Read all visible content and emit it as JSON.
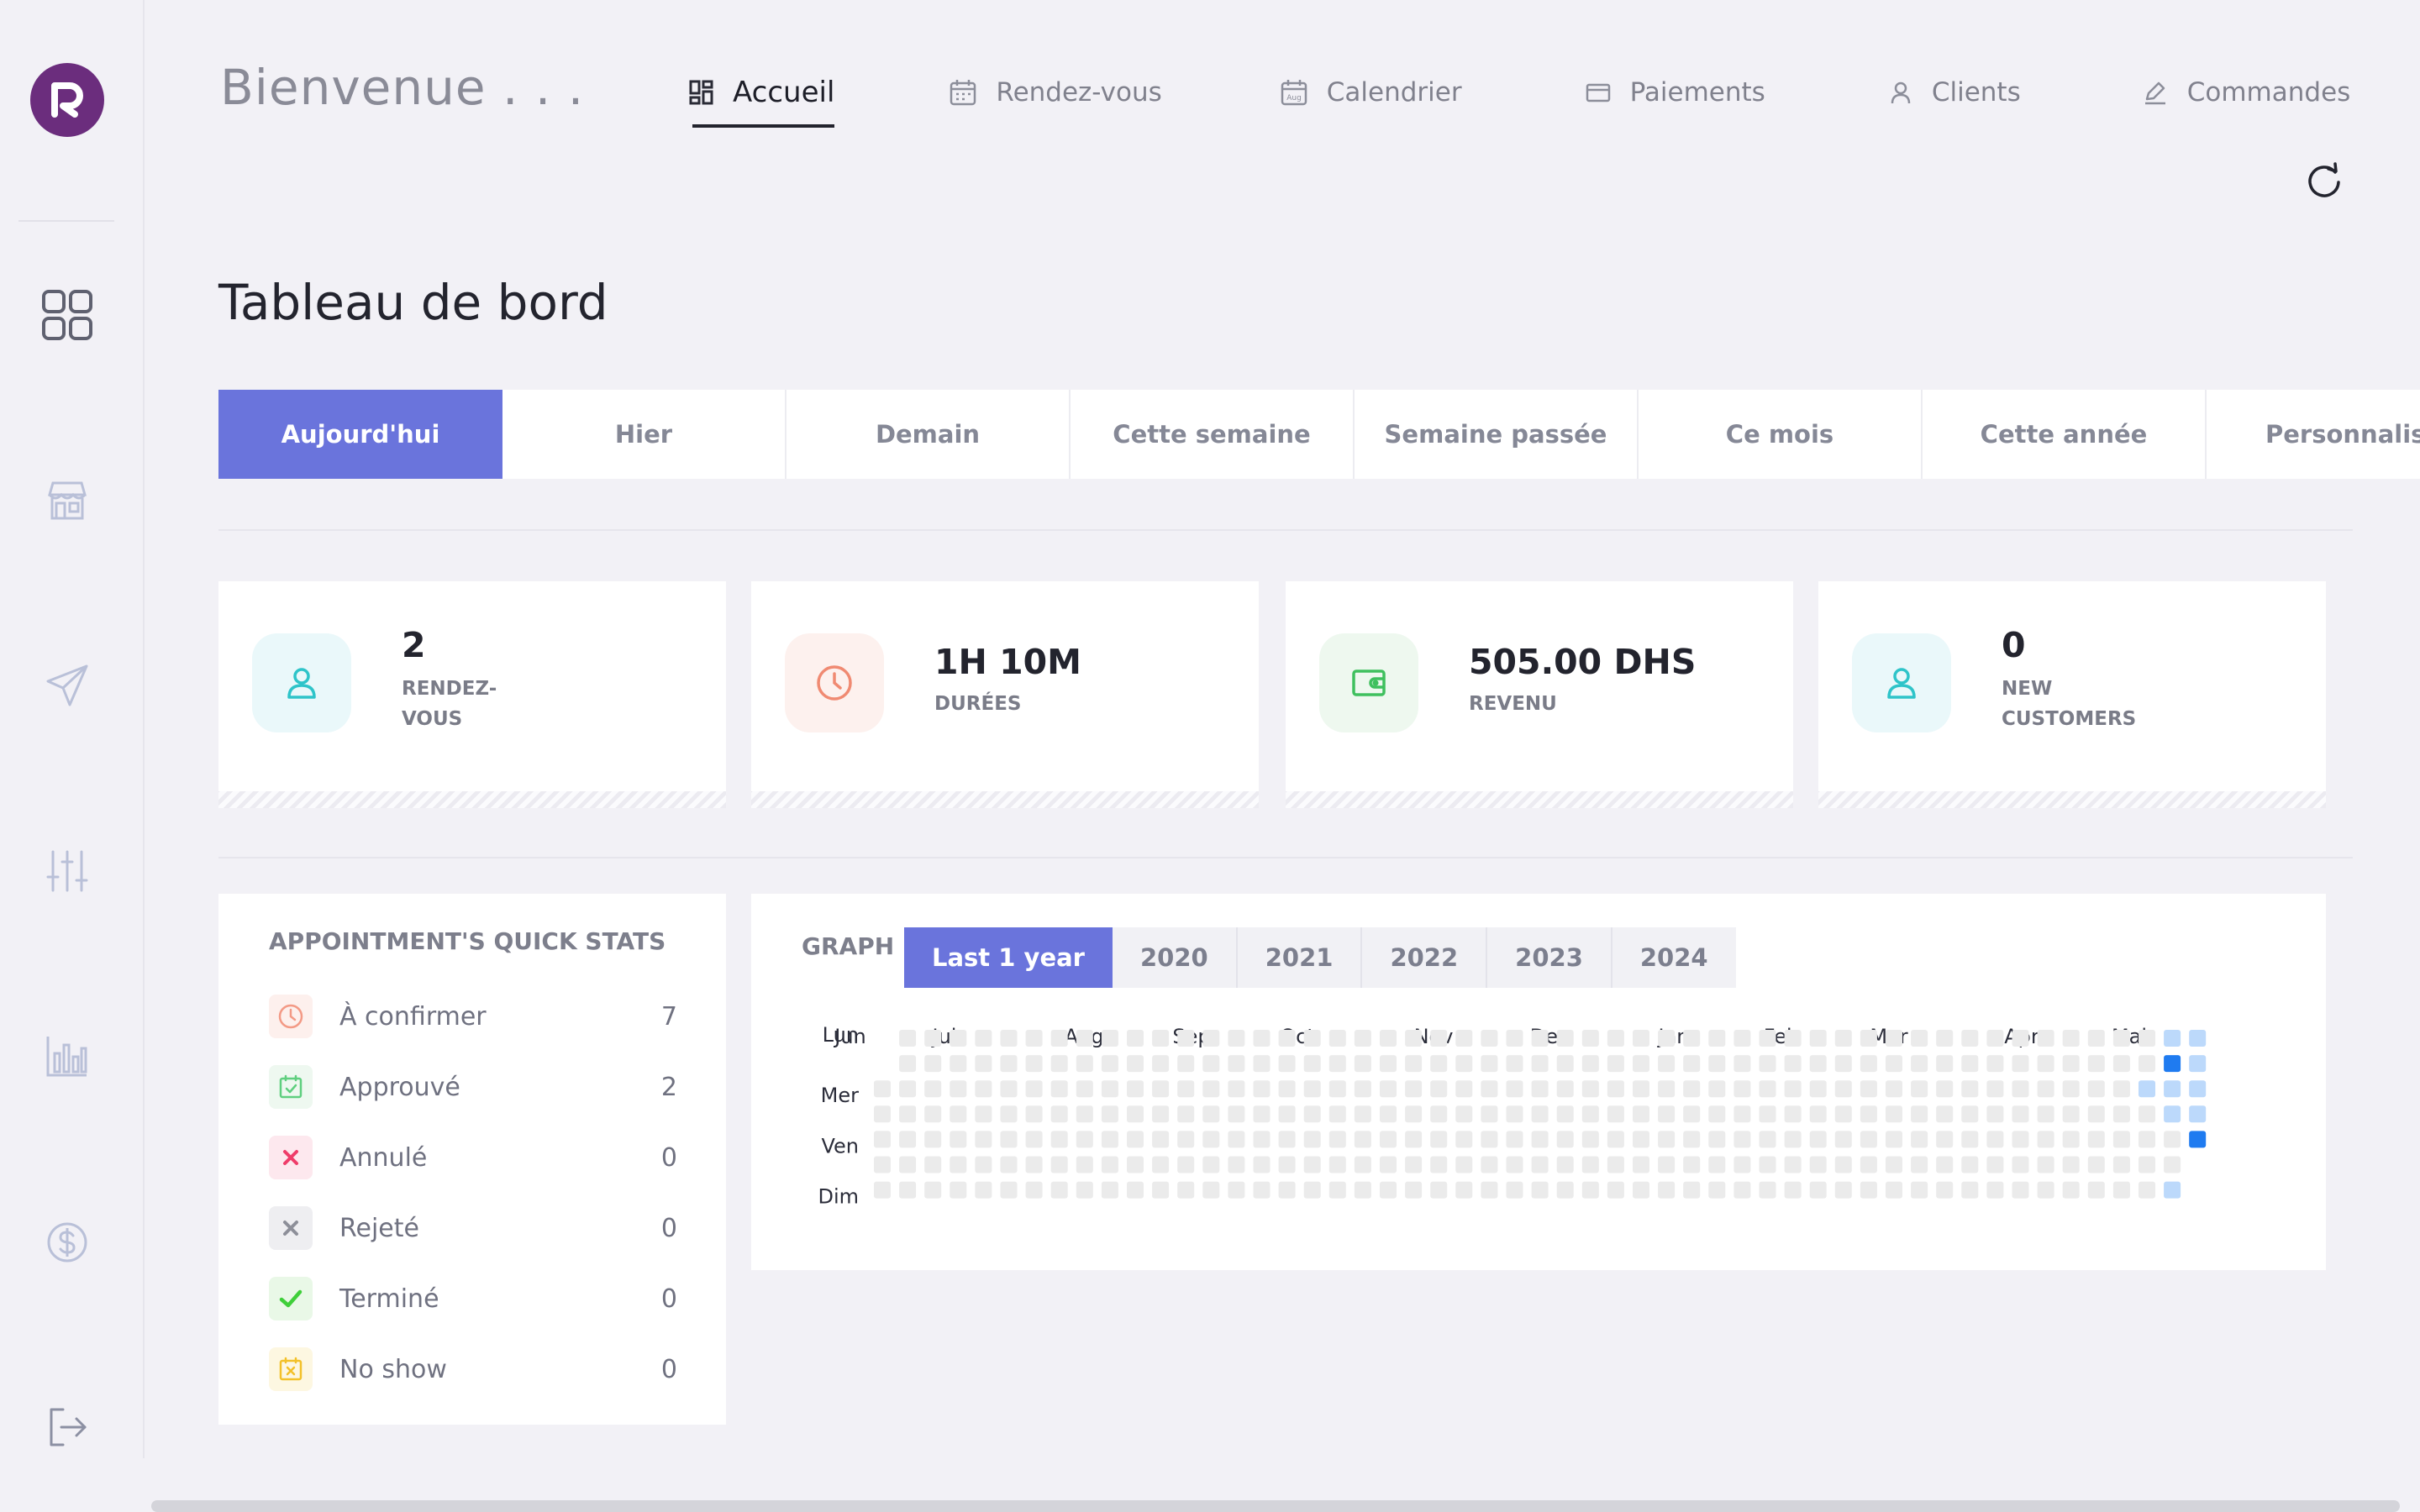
{
  "header": {
    "greeting": "Bienvenue . . .",
    "page_title": "Tableau de bord"
  },
  "topnav": [
    {
      "label": "Accueil",
      "icon": "dashboard-icon",
      "active": true
    },
    {
      "label": "Rendez-vous",
      "icon": "calendar-icon",
      "active": false
    },
    {
      "label": "Calendrier",
      "icon": "calendar-aug-icon",
      "active": false
    },
    {
      "label": "Paiements",
      "icon": "credit-card-icon",
      "active": false
    },
    {
      "label": "Clients",
      "icon": "user-icon",
      "active": false
    },
    {
      "label": "Commandes",
      "icon": "pencil-icon",
      "active": false
    }
  ],
  "sidebar": {
    "logo_letter": "R",
    "icons": [
      "grid-icon",
      "store-icon",
      "send-icon",
      "sliders-icon",
      "chart-icon",
      "dollar-icon",
      "logout-icon"
    ]
  },
  "period_tabs": [
    "Aujourd'hui",
    "Hier",
    "Demain",
    "Cette semaine",
    "Semaine passée",
    "Ce mois",
    "Cette année",
    "Personnalise"
  ],
  "active_period": "Aujourd'hui",
  "stats": [
    {
      "value": "2",
      "label_line1": "RENDEZ-",
      "label_line2": "VOUS",
      "icon": "user-icon",
      "color": "#2ec4c9",
      "bg": "#eaf8fa"
    },
    {
      "value": "1H 10M",
      "label_line1": "DURÉES",
      "label_line2": "",
      "icon": "clock-icon",
      "color": "#f08a72",
      "bg": "#fdf1ee"
    },
    {
      "value": "505.00 DHS",
      "label_line1": "REVENU",
      "label_line2": "",
      "icon": "wallet-icon",
      "color": "#3fc05e",
      "bg": "#eef8ef"
    },
    {
      "value": "0",
      "label_line1": "NEW",
      "label_line2": "CUSTOMERS",
      "icon": "user-icon",
      "color": "#2ec4c9",
      "bg": "#eaf8fa"
    }
  ],
  "quick_stats": {
    "title": "APPOINTMENT'S QUICK STATS",
    "rows": [
      {
        "label": "À confirmer",
        "count": "7",
        "icon": "clock-icon",
        "color": "#f39a86",
        "bg": "#fdf0ed"
      },
      {
        "label": "Approuvé",
        "count": "2",
        "icon": "calendar-check-icon",
        "color": "#5fcf7f",
        "bg": "#eef8f0"
      },
      {
        "label": "Annulé",
        "count": "0",
        "icon": "x-icon",
        "color": "#ef3d6a",
        "bg": "#fde8ee"
      },
      {
        "label": "Rejeté",
        "count": "0",
        "icon": "x-icon",
        "color": "#8d8f99",
        "bg": "#eeeef1"
      },
      {
        "label": "Terminé",
        "count": "0",
        "icon": "check-icon",
        "color": "#3fcf3a",
        "bg": "#e9f8e7"
      },
      {
        "label": "No show",
        "count": "0",
        "icon": "calendar-x-icon",
        "color": "#f3c12a",
        "bg": "#fdf7e1"
      }
    ]
  },
  "graph": {
    "label": "GRAPH",
    "tabs": [
      "Last 1 year",
      "2020",
      "2021",
      "2022",
      "2023",
      "2024"
    ],
    "active_tab": "Last 1 year",
    "months": [
      "Jun",
      "Jul",
      "Aug",
      "Sep",
      "Oct",
      "Nov",
      "Dec",
      "Jan",
      "Feb",
      "Mar",
      "Apr",
      "Mai"
    ],
    "days": [
      "Lun",
      "Mer",
      "Ven",
      "Dim"
    ],
    "colors": {
      "empty": "#ebebeb",
      "low": "#bcd9fb",
      "high": "#1f7bf0"
    }
  },
  "chart_data": {
    "type": "heatmap",
    "title": "",
    "x_labels": [
      "Jun",
      "Jul",
      "Aug",
      "Sep",
      "Oct",
      "Nov",
      "Dec",
      "Jan",
      "Feb",
      "Mar",
      "Apr",
      "Mai"
    ],
    "y_labels": [
      "Lun",
      "Mer",
      "Ven",
      "Dim"
    ],
    "weeks": 53,
    "highlighted_cells": [
      {
        "week": 51,
        "day": 0,
        "level": "low"
      },
      {
        "week": 51,
        "day": 1,
        "level": "high"
      },
      {
        "week": 51,
        "day": 2,
        "level": "low"
      },
      {
        "week": 51,
        "day": 3,
        "level": "low"
      },
      {
        "week": 51,
        "day": 6,
        "level": "low"
      },
      {
        "week": 50,
        "day": 2,
        "level": "low"
      },
      {
        "week": 52,
        "day": 0,
        "level": "low"
      },
      {
        "week": 52,
        "day": 1,
        "level": "low"
      },
      {
        "week": 52,
        "day": 2,
        "level": "low"
      },
      {
        "week": 52,
        "day": 3,
        "level": "low"
      },
      {
        "week": 52,
        "day": 4,
        "level": "high"
      }
    ]
  }
}
